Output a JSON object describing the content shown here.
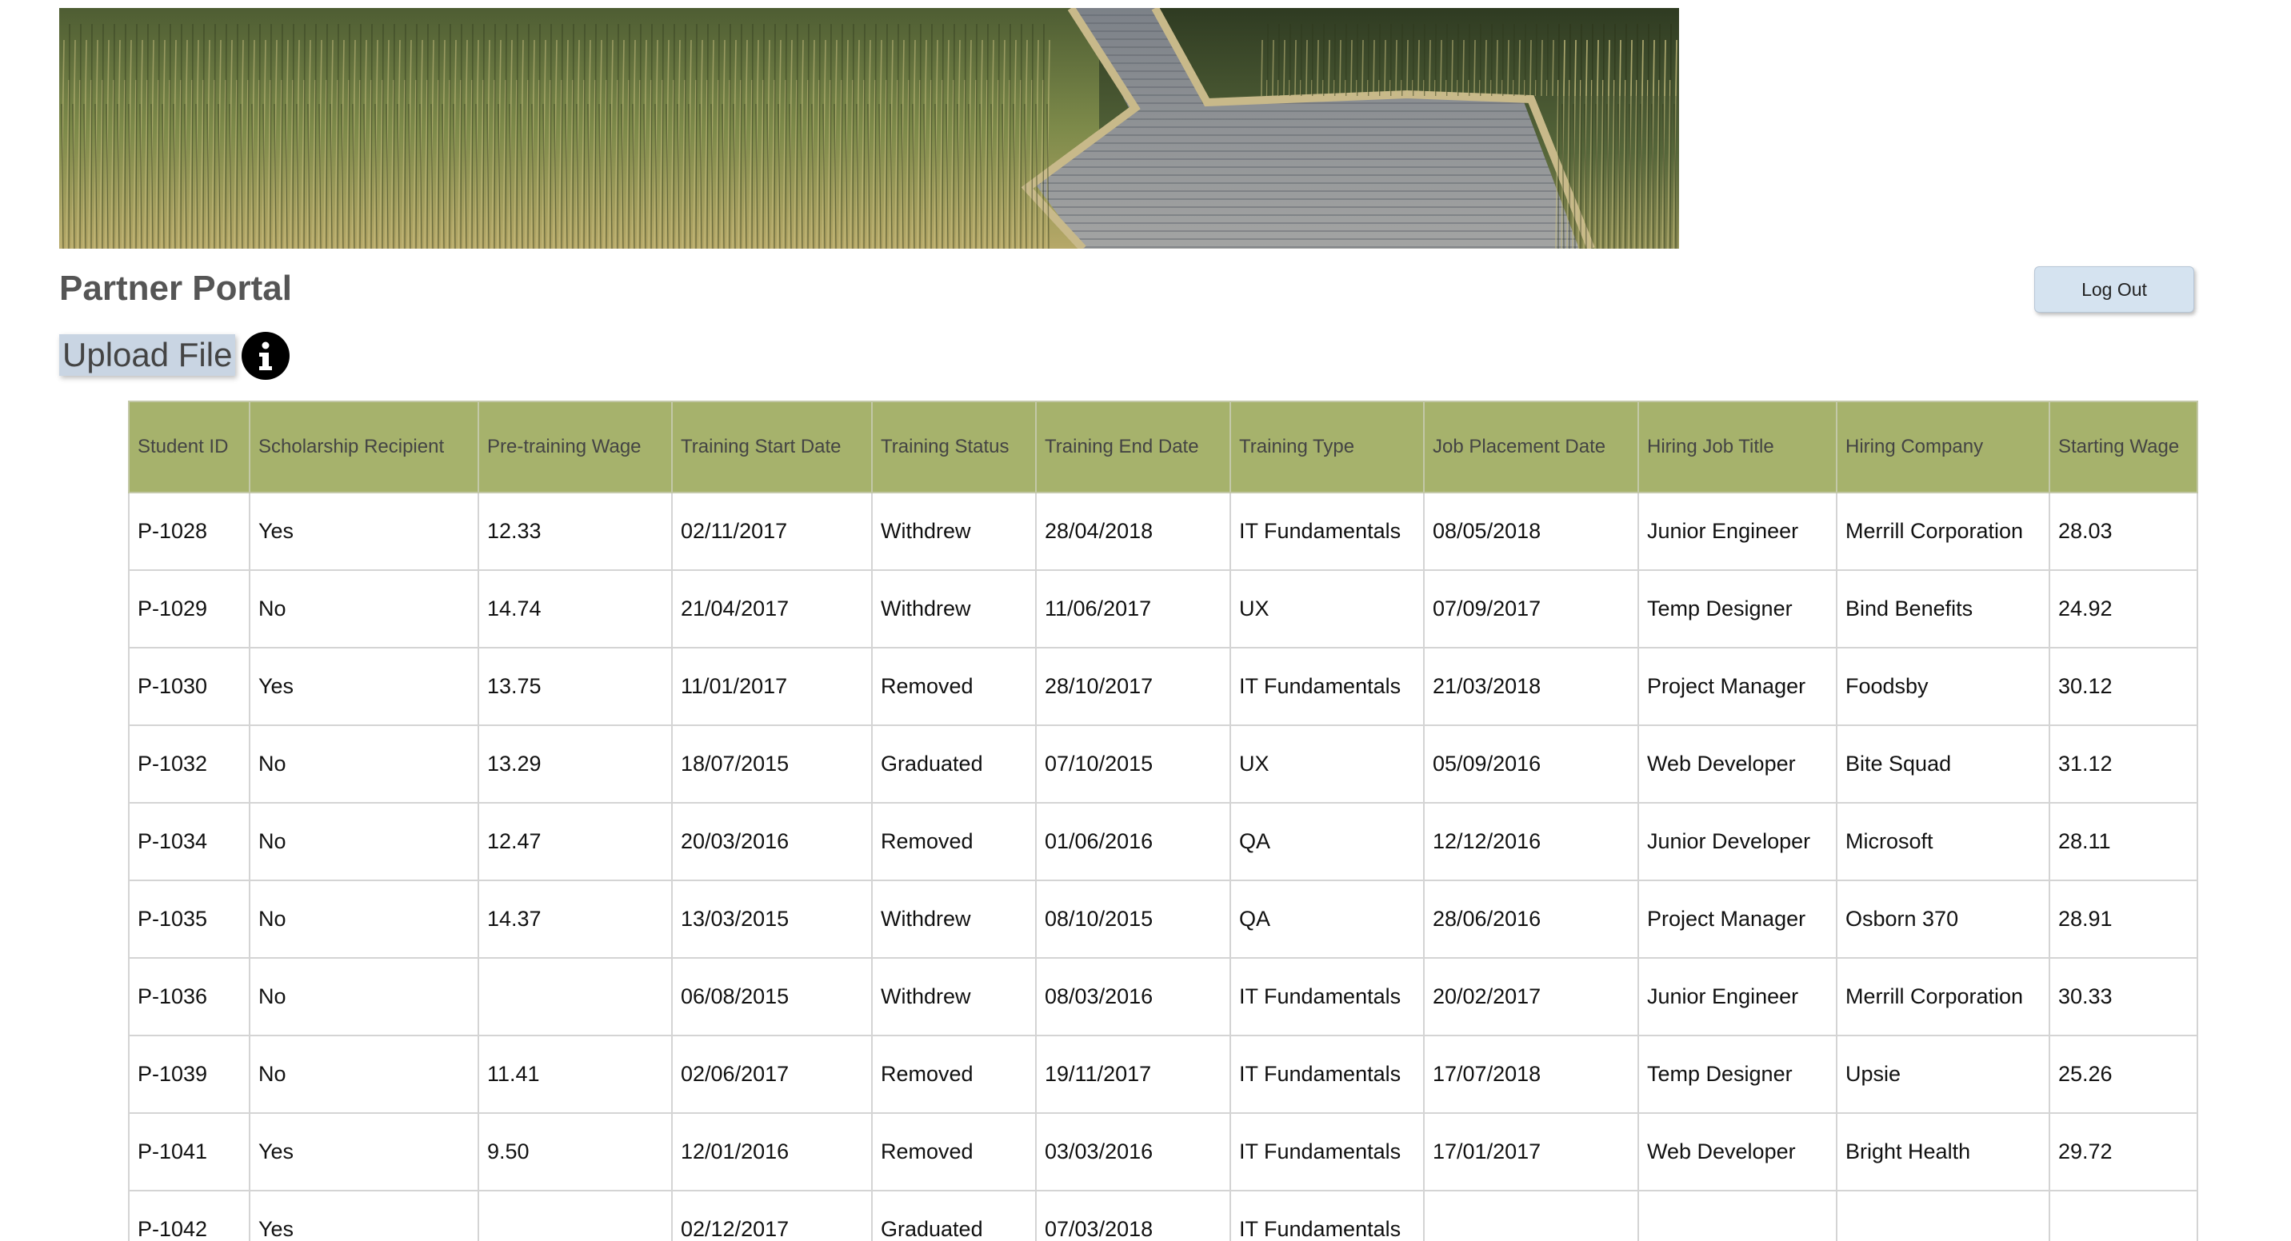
{
  "header": {
    "title": "Partner Portal",
    "logout_label": "Log Out",
    "upload_label": "Upload File",
    "info_icon": "info-icon"
  },
  "table": {
    "columns": [
      "Student ID",
      "Scholarship Recipient",
      "Pre-training Wage",
      "Training Start Date",
      "Training Status",
      "Training End Date",
      "Training Type",
      "Job Placement Date",
      "Hiring Job Title",
      "Hiring Company",
      "Starting Wage"
    ],
    "rows": [
      [
        "P-1028",
        "Yes",
        "12.33",
        "02/11/2017",
        "Withdrew",
        "28/04/2018",
        "IT Fundamentals",
        "08/05/2018",
        "Junior Engineer",
        "Merrill Corporation",
        "28.03"
      ],
      [
        "P-1029",
        "No",
        "14.74",
        "21/04/2017",
        "Withdrew",
        "11/06/2017",
        "UX",
        "07/09/2017",
        "Temp Designer",
        "Bind Benefits",
        "24.92"
      ],
      [
        "P-1030",
        "Yes",
        "13.75",
        "11/01/2017",
        "Removed",
        "28/10/2017",
        "IT Fundamentals",
        "21/03/2018",
        "Project Manager",
        "Foodsby",
        "30.12"
      ],
      [
        "P-1032",
        "No",
        "13.29",
        "18/07/2015",
        "Graduated",
        "07/10/2015",
        "UX",
        "05/09/2016",
        "Web Developer",
        "Bite Squad",
        "31.12"
      ],
      [
        "P-1034",
        "No",
        "12.47",
        "20/03/2016",
        "Removed",
        "01/06/2016",
        "QA",
        "12/12/2016",
        "Junior Developer",
        "Microsoft",
        "28.11"
      ],
      [
        "P-1035",
        "No",
        "14.37",
        "13/03/2015",
        "Withdrew",
        "08/10/2015",
        "QA",
        "28/06/2016",
        "Project Manager",
        "Osborn 370",
        "28.91"
      ],
      [
        "P-1036",
        "No",
        "",
        "06/08/2015",
        "Withdrew",
        "08/03/2016",
        "IT Fundamentals",
        "20/02/2017",
        "Junior Engineer",
        "Merrill Corporation",
        "30.33"
      ],
      [
        "P-1039",
        "No",
        "11.41",
        "02/06/2017",
        "Removed",
        "19/11/2017",
        "IT Fundamentals",
        "17/07/2018",
        "Temp Designer",
        "Upsie",
        "25.26"
      ],
      [
        "P-1041",
        "Yes",
        "9.50",
        "12/01/2016",
        "Removed",
        "03/03/2016",
        "IT Fundamentals",
        "17/01/2017",
        "Web Developer",
        "Bright Health",
        "29.72"
      ],
      [
        "P-1042",
        "Yes",
        "",
        "02/12/2017",
        "Graduated",
        "07/03/2018",
        "IT Fundamentals",
        "",
        "",
        "",
        ""
      ]
    ]
  },
  "colors": {
    "header_bg": "#a6b26c",
    "button_bg": "#d5e3f0",
    "title_color": "#555555"
  }
}
